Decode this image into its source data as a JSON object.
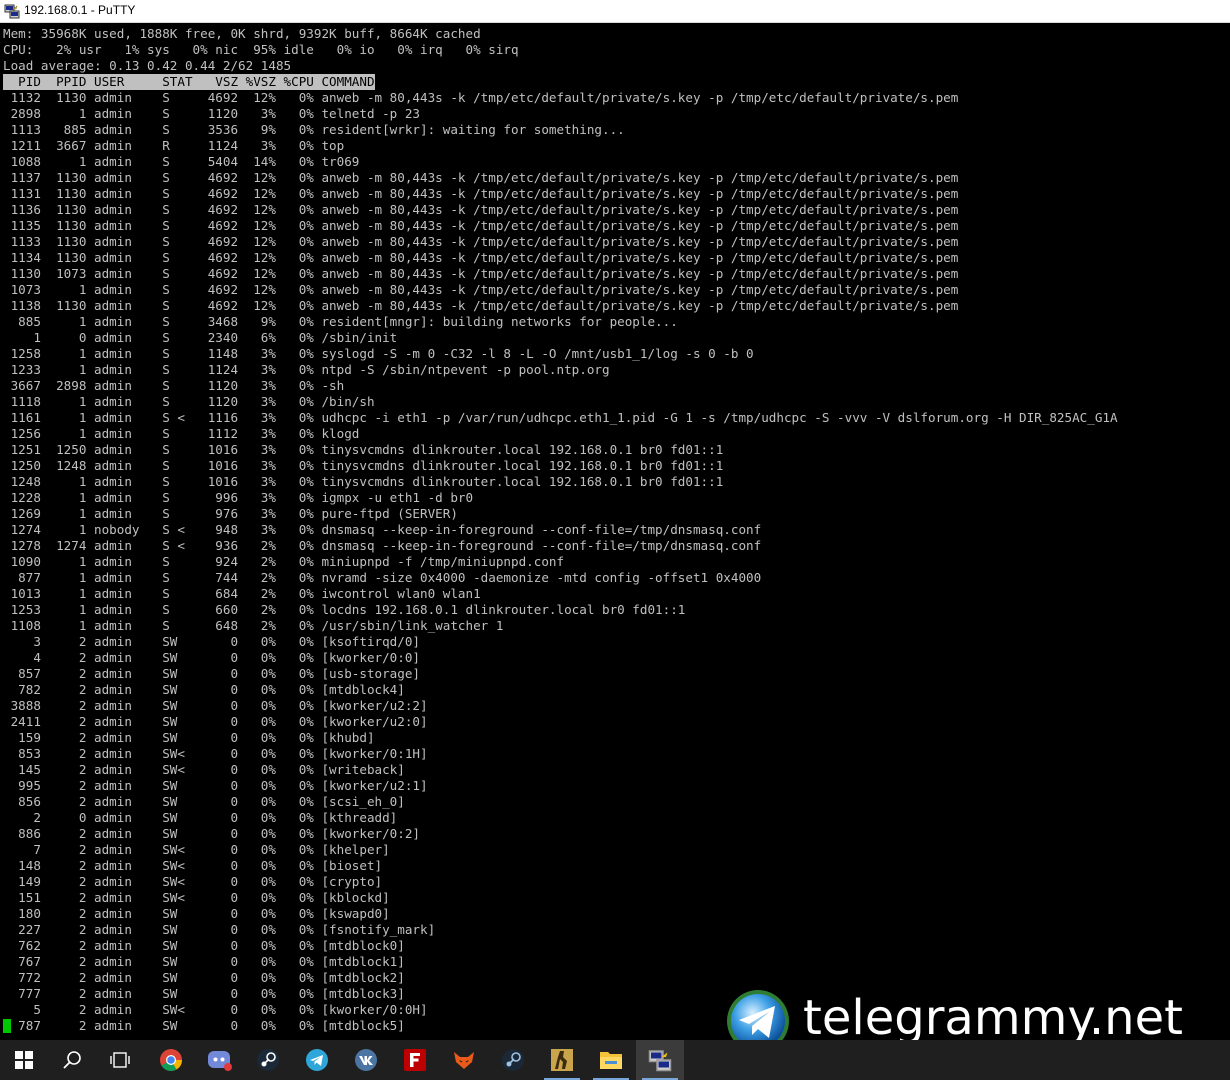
{
  "window": {
    "title": "192.168.0.1 - PuTTY"
  },
  "terminal": {
    "summary": [
      "Mem: 35968K used, 1888K free, 0K shrd, 9392K buff, 8664K cached",
      "CPU:   2% usr   1% sys   0% nic  95% idle   0% io   0% irq   0% sirq",
      "Load average: 0.13 0.42 0.44 2/62 1485"
    ],
    "header": "  PID  PPID USER     STAT   VSZ %VSZ %CPU COMMAND",
    "rows": [
      " 1132  1130 admin    S     4692  12%   0% anweb -m 80,443s -k /tmp/etc/default/private/s.key -p /tmp/etc/default/private/s.pem",
      " 2898     1 admin    S     1120   3%   0% telnetd -p 23",
      " 1113   885 admin    S     3536   9%   0% resident[wrkr]: waiting for something...",
      " 1211  3667 admin    R     1124   3%   0% top",
      " 1088     1 admin    S     5404  14%   0% tr069",
      " 1137  1130 admin    S     4692  12%   0% anweb -m 80,443s -k /tmp/etc/default/private/s.key -p /tmp/etc/default/private/s.pem",
      " 1131  1130 admin    S     4692  12%   0% anweb -m 80,443s -k /tmp/etc/default/private/s.key -p /tmp/etc/default/private/s.pem",
      " 1136  1130 admin    S     4692  12%   0% anweb -m 80,443s -k /tmp/etc/default/private/s.key -p /tmp/etc/default/private/s.pem",
      " 1135  1130 admin    S     4692  12%   0% anweb -m 80,443s -k /tmp/etc/default/private/s.key -p /tmp/etc/default/private/s.pem",
      " 1133  1130 admin    S     4692  12%   0% anweb -m 80,443s -k /tmp/etc/default/private/s.key -p /tmp/etc/default/private/s.pem",
      " 1134  1130 admin    S     4692  12%   0% anweb -m 80,443s -k /tmp/etc/default/private/s.key -p /tmp/etc/default/private/s.pem",
      " 1130  1073 admin    S     4692  12%   0% anweb -m 80,443s -k /tmp/etc/default/private/s.key -p /tmp/etc/default/private/s.pem",
      " 1073     1 admin    S     4692  12%   0% anweb -m 80,443s -k /tmp/etc/default/private/s.key -p /tmp/etc/default/private/s.pem",
      " 1138  1130 admin    S     4692  12%   0% anweb -m 80,443s -k /tmp/etc/default/private/s.key -p /tmp/etc/default/private/s.pem",
      "  885     1 admin    S     3468   9%   0% resident[mngr]: building networks for people...",
      "    1     0 admin    S     2340   6%   0% /sbin/init",
      " 1258     1 admin    S     1148   3%   0% syslogd -S -m 0 -C32 -l 8 -L -O /mnt/usb1_1/log -s 0 -b 0",
      " 1233     1 admin    S     1124   3%   0% ntpd -S /sbin/ntpevent -p pool.ntp.org",
      " 3667  2898 admin    S     1120   3%   0% -sh",
      " 1118     1 admin    S     1120   3%   0% /bin/sh",
      " 1161     1 admin    S <   1116   3%   0% udhcpc -i eth1 -p /var/run/udhcpc.eth1_1.pid -G 1 -s /tmp/udhcpc -S -vvv -V dslforum.org -H DIR_825AC_G1A",
      " 1256     1 admin    S     1112   3%   0% klogd",
      " 1251  1250 admin    S     1016   3%   0% tinysvcmdns dlinkrouter.local 192.168.0.1 br0 fd01::1",
      " 1250  1248 admin    S     1016   3%   0% tinysvcmdns dlinkrouter.local 192.168.0.1 br0 fd01::1",
      " 1248     1 admin    S     1016   3%   0% tinysvcmdns dlinkrouter.local 192.168.0.1 br0 fd01::1",
      " 1228     1 admin    S      996   3%   0% igmpx -u eth1 -d br0",
      " 1269     1 admin    S      976   3%   0% pure-ftpd (SERVER)",
      " 1274     1 nobody   S <    948   3%   0% dnsmasq --keep-in-foreground --conf-file=/tmp/dnsmasq.conf",
      " 1278  1274 admin    S <    936   2%   0% dnsmasq --keep-in-foreground --conf-file=/tmp/dnsmasq.conf",
      " 1090     1 admin    S      924   2%   0% miniupnpd -f /tmp/miniupnpd.conf",
      "  877     1 admin    S      744   2%   0% nvramd -size 0x4000 -daemonize -mtd config -offset1 0x4000",
      " 1013     1 admin    S      684   2%   0% iwcontrol wlan0 wlan1",
      " 1253     1 admin    S      660   2%   0% locdns 192.168.0.1 dlinkrouter.local br0 fd01::1",
      " 1108     1 admin    S      648   2%   0% /usr/sbin/link_watcher 1",
      "    3     2 admin    SW       0   0%   0% [ksoftirqd/0]",
      "    4     2 admin    SW       0   0%   0% [kworker/0:0]",
      "  857     2 admin    SW       0   0%   0% [usb-storage]",
      "  782     2 admin    SW       0   0%   0% [mtdblock4]",
      " 3888     2 admin    SW       0   0%   0% [kworker/u2:2]",
      " 2411     2 admin    SW       0   0%   0% [kworker/u2:0]",
      "  159     2 admin    SW       0   0%   0% [khubd]",
      "  853     2 admin    SW<      0   0%   0% [kworker/0:1H]",
      "  145     2 admin    SW<      0   0%   0% [writeback]",
      "  995     2 admin    SW       0   0%   0% [kworker/u2:1]",
      "  856     2 admin    SW       0   0%   0% [scsi_eh_0]",
      "    2     0 admin    SW       0   0%   0% [kthreadd]",
      "  886     2 admin    SW       0   0%   0% [kworker/0:2]",
      "    7     2 admin    SW<      0   0%   0% [khelper]",
      "  148     2 admin    SW<      0   0%   0% [bioset]",
      "  149     2 admin    SW<      0   0%   0% [crypto]",
      "  151     2 admin    SW<      0   0%   0% [kblockd]",
      "  180     2 admin    SW       0   0%   0% [kswapd0]",
      "  227     2 admin    SW       0   0%   0% [fsnotify_mark]",
      "  762     2 admin    SW       0   0%   0% [mtdblock0]",
      "  767     2 admin    SW       0   0%   0% [mtdblock1]",
      "  772     2 admin    SW       0   0%   0% [mtdblock2]",
      "  777     2 admin    SW       0   0%   0% [mtdblock3]",
      "    5     2 admin    SW<      0   0%   0% [kworker/0:0H]",
      "  787     2 admin    SW       0   0%   0% [mtdblock5]"
    ]
  },
  "watermark": {
    "text": "telegrammy.net"
  },
  "taskbar": {
    "items": [
      {
        "name": "start-button",
        "icon": "windows-icon"
      },
      {
        "name": "search-button",
        "icon": "search-icon"
      },
      {
        "name": "task-view-button",
        "icon": "task-view-icon"
      },
      {
        "name": "taskbar-chrome",
        "icon": "chrome-icon"
      },
      {
        "name": "taskbar-discord",
        "icon": "discord-icon"
      },
      {
        "name": "taskbar-steam",
        "icon": "steam-icon"
      },
      {
        "name": "taskbar-telegram",
        "icon": "telegram-icon"
      },
      {
        "name": "taskbar-vk",
        "icon": "vk-icon"
      },
      {
        "name": "taskbar-filezilla",
        "icon": "filezilla-icon"
      },
      {
        "name": "taskbar-fox-app",
        "icon": "fox-icon"
      },
      {
        "name": "taskbar-steam-2",
        "icon": "steam-icon"
      },
      {
        "name": "taskbar-cs",
        "icon": "counter-strike-icon"
      },
      {
        "name": "taskbar-explorer",
        "icon": "folder-icon"
      },
      {
        "name": "taskbar-putty",
        "icon": "putty-icon"
      }
    ]
  }
}
